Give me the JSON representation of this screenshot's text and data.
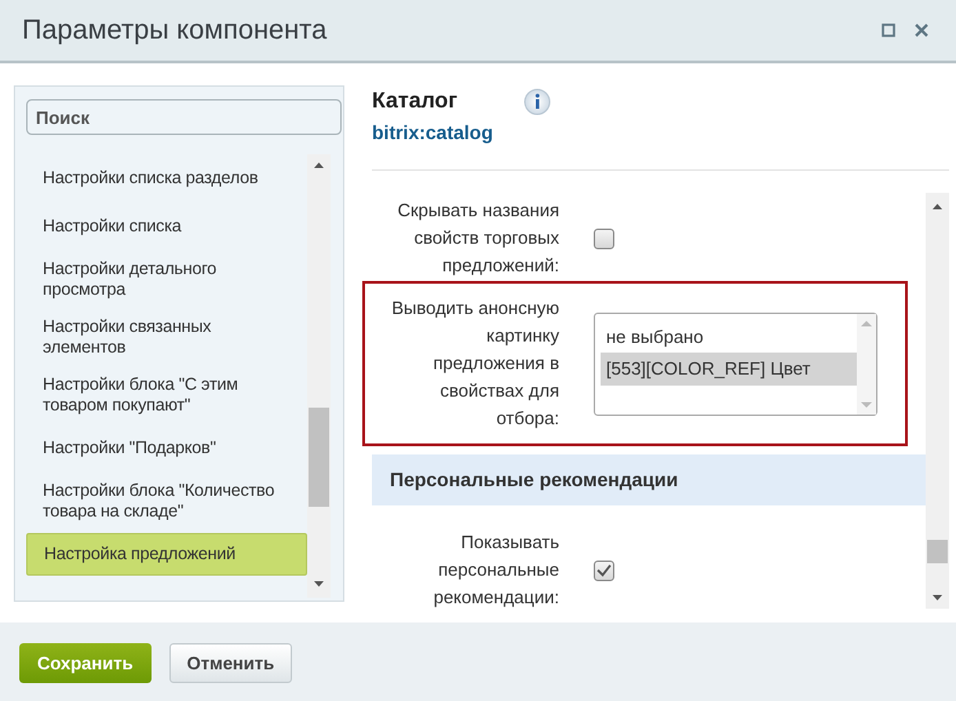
{
  "window": {
    "title": "Параметры компонента"
  },
  "sidebar": {
    "search": {
      "placeholder": "Поиск"
    },
    "items": [
      {
        "label": "Настройки списка разделов",
        "selected": false
      },
      {
        "label": "Настройки списка",
        "selected": false
      },
      {
        "label": "Настройки детального просмотра",
        "selected": false
      },
      {
        "label": "Настройки связанных элементов",
        "selected": false
      },
      {
        "label": "Настройки блока \"С этим товаром покупают\"",
        "selected": false
      },
      {
        "label": "Настройки \"Подарков\"",
        "selected": false
      },
      {
        "label": "Настройки блока \"Количество товара на складе\"",
        "selected": false
      },
      {
        "label": "Настройка предложений",
        "selected": true
      }
    ]
  },
  "component": {
    "title": "Каталог",
    "code": "bitrix:catalog"
  },
  "rows": [
    {
      "kind": "checkbox",
      "label": "Скрывать названия свойств торговых предложений:",
      "checked": false,
      "highlighted": false
    },
    {
      "kind": "listbox",
      "label": "Выводить анонсную картинку предложения в свойствах для отбора:",
      "highlighted": true,
      "options": [
        {
          "label": "не выбрано",
          "selected": false
        },
        {
          "label": "[553][COLOR_REF] Цвет",
          "selected": true
        }
      ]
    },
    {
      "kind": "section",
      "label": "Персональные рекомендации"
    },
    {
      "kind": "checkbox",
      "label": "Показывать персональные рекомендации:",
      "checked": true,
      "highlighted": false
    }
  ],
  "buttons": [
    {
      "label": "Сохранить",
      "kind": "primary"
    },
    {
      "label": "Отменить",
      "kind": "secondary"
    }
  ]
}
